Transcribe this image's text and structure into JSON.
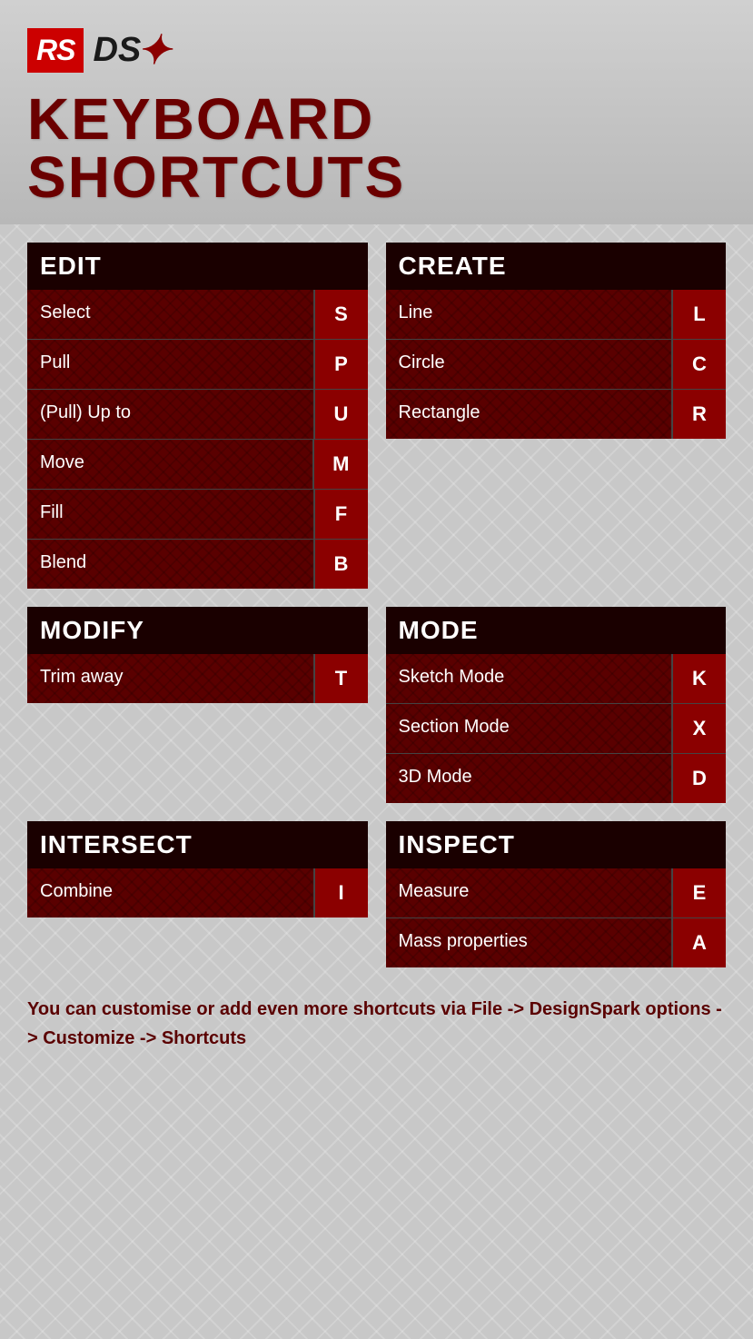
{
  "logo": {
    "rs": "RS",
    "ds": "DS",
    "arrow": "⚡"
  },
  "title": "KEYBOARD SHORTCUTS",
  "sections": {
    "edit": {
      "header": "EDIT",
      "items": [
        {
          "label": "Select",
          "key": "S"
        },
        {
          "label": "Pull",
          "key": "P"
        },
        {
          "label": "(Pull) Up to",
          "key": "U"
        },
        {
          "label": "Move",
          "key": "M"
        },
        {
          "label": "Fill",
          "key": "F"
        },
        {
          "label": "Blend",
          "key": "B"
        }
      ]
    },
    "create": {
      "header": "CREATE",
      "items": [
        {
          "label": "Line",
          "key": "L"
        },
        {
          "label": "Circle",
          "key": "C"
        },
        {
          "label": "Rectangle",
          "key": "R"
        }
      ]
    },
    "modify": {
      "header": "MODIFY",
      "items": [
        {
          "label": "Trim away",
          "key": "T"
        }
      ]
    },
    "mode": {
      "header": "MODE",
      "items": [
        {
          "label": "Sketch Mode",
          "key": "K"
        },
        {
          "label": "Section Mode",
          "key": "X"
        },
        {
          "label": "3D Mode",
          "key": "D"
        }
      ]
    },
    "intersect": {
      "header": "INTERSECT",
      "items": [
        {
          "label": "Combine",
          "key": "I"
        }
      ]
    },
    "inspect": {
      "header": "INSPECT",
      "items": [
        {
          "label": "Measure",
          "key": "E"
        },
        {
          "label": "Mass properties",
          "key": "A"
        }
      ]
    }
  },
  "footer": "You can customise or add even more shortcuts via\nFile -> DesignSpark options -> Customize -> Shortcuts"
}
